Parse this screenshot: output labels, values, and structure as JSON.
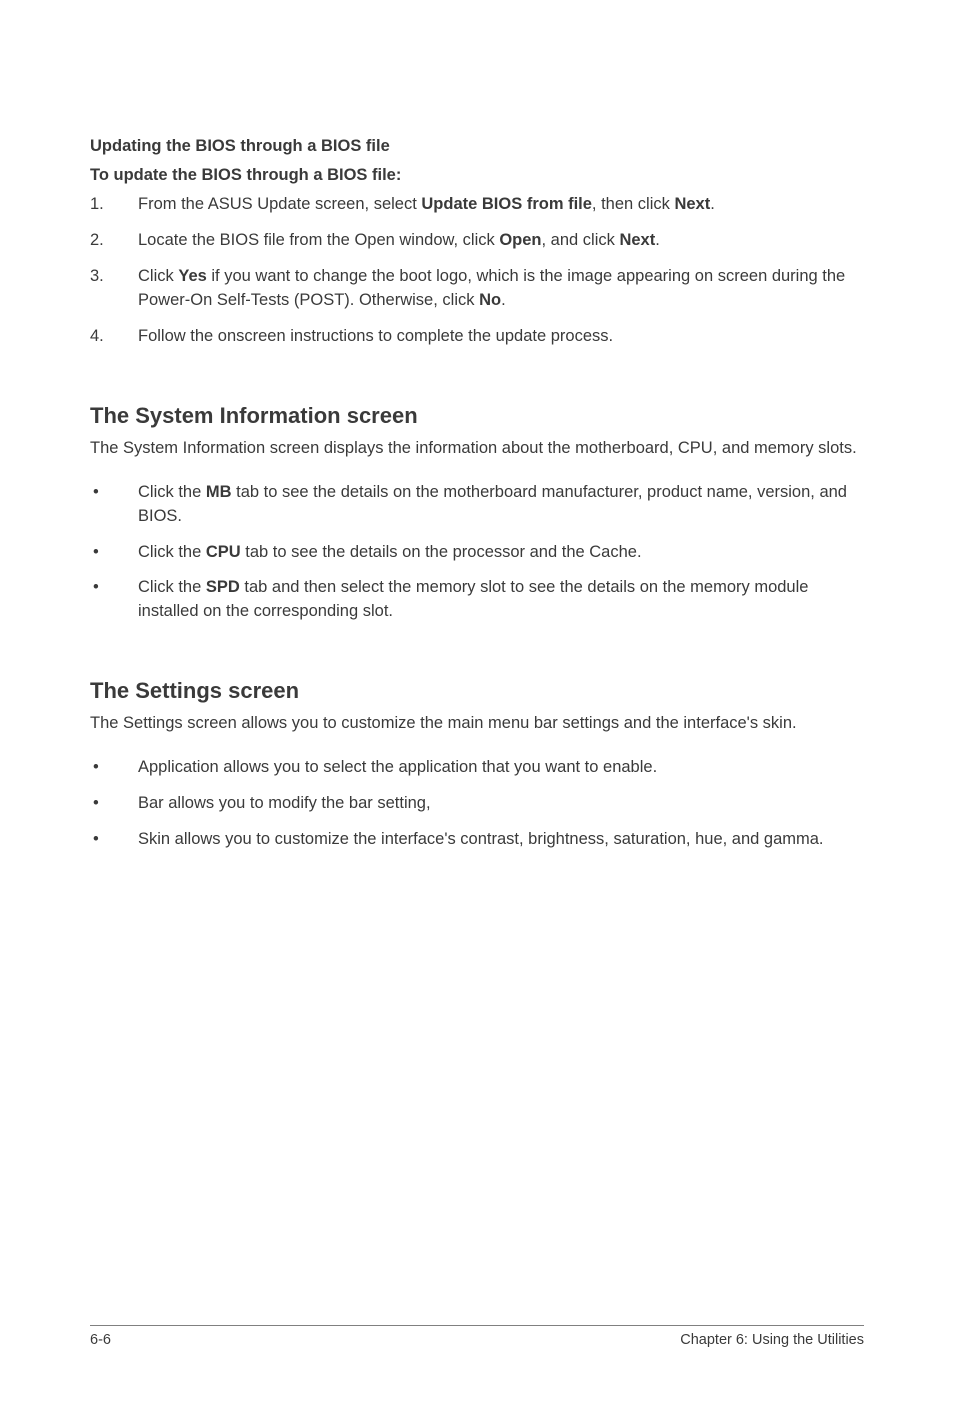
{
  "section1": {
    "heading1": "Updating the BIOS through a BIOS file",
    "heading2": "To update the BIOS through a BIOS file:",
    "steps": [
      {
        "num": "1.",
        "pre": "From the ASUS Update screen, select ",
        "bold1": "Update BIOS from file",
        "mid": ", then click ",
        "bold2": "Next",
        "post": "."
      },
      {
        "num": "2.",
        "pre": "Locate the BIOS file from the Open window, click ",
        "bold1": "Open",
        "mid": ", and click ",
        "bold2": "Next",
        "post": "."
      },
      {
        "num": "3.",
        "pre": "Click ",
        "bold1": "Yes",
        "mid": " if you want to change the boot logo, which is the image appearing on screen during the Power-On Self-Tests (POST). Otherwise, click ",
        "bold2": "No",
        "post": "."
      },
      {
        "num": "4.",
        "text": "Follow the onscreen instructions to complete the update process."
      }
    ]
  },
  "section2": {
    "heading": "The System Information screen",
    "para": "The System Information screen displays the information about the motherboard, CPU, and memory slots.",
    "bullets": [
      {
        "pre": "Click the ",
        "bold": "MB",
        "post": " tab to see the details on the motherboard manufacturer, product name, version, and BIOS."
      },
      {
        "pre": "Click the ",
        "bold": "CPU",
        "post": " tab to see the details on the processor and the Cache."
      },
      {
        "pre": "Click the ",
        "bold": "SPD",
        "post": " tab and then select the memory slot to see the details on the memory module installed on the corresponding slot."
      }
    ]
  },
  "section3": {
    "heading": "The Settings screen",
    "para": "The Settings screen allows you to customize the main menu bar settings and the interface's skin.",
    "bullets": [
      {
        "text": "Application allows you to select the application that you want to enable."
      },
      {
        "text": "Bar allows you to modify the bar setting,"
      },
      {
        "text": "Skin allows you to customize the interface's contrast, brightness, saturation, hue, and gamma."
      }
    ]
  },
  "footer": {
    "left": "6-6",
    "right": "Chapter 6: Using the Utilities"
  }
}
